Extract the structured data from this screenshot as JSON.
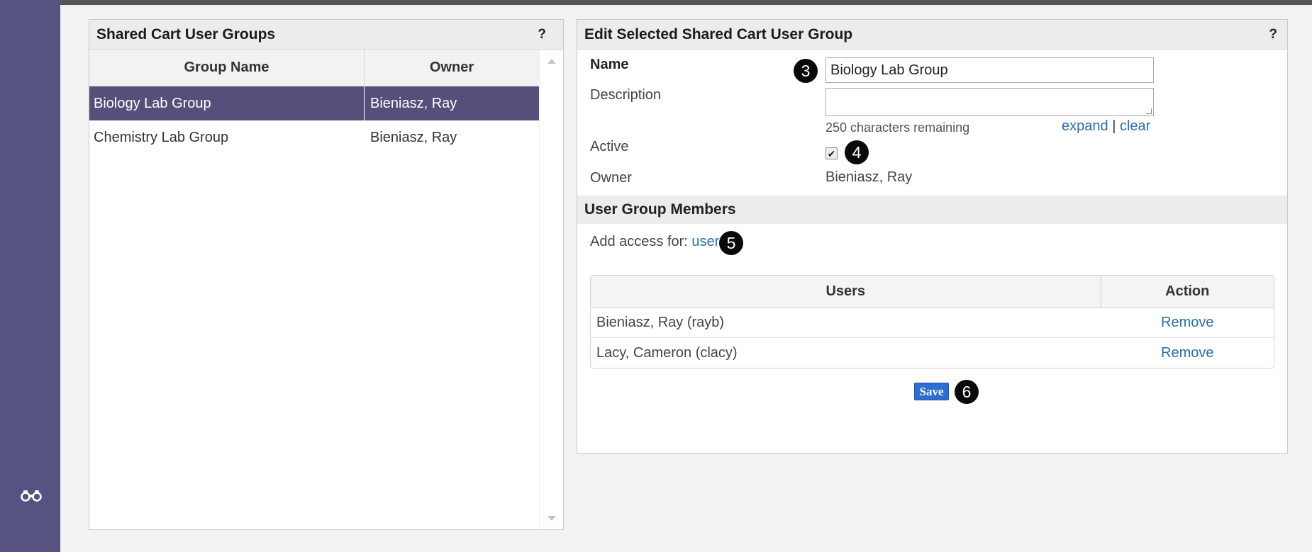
{
  "left_panel": {
    "title": "Shared Cart User Groups",
    "help": "?",
    "columns": [
      "Group Name",
      "Owner"
    ],
    "rows": [
      {
        "group_name": "Biology Lab Group",
        "owner": "Bieniasz, Ray",
        "selected": true
      },
      {
        "group_name": "Chemistry Lab Group",
        "owner": "Bieniasz, Ray",
        "selected": false
      }
    ]
  },
  "right_panel": {
    "title": "Edit Selected Shared Cart User Group",
    "help": "?",
    "name_label": "Name",
    "name_value": "Biology Lab Group",
    "description_label": "Description",
    "description_value": "",
    "chars_remaining": "250 characters remaining",
    "expand_label": "expand",
    "link_separator": "|",
    "clear_label": "clear",
    "active_label": "Active",
    "active_checked": true,
    "owner_label": "Owner",
    "owner_value": "Bieniasz, Ray",
    "members_section_title": "User Group Members",
    "add_access_prefix": "Add access for:",
    "add_access_link": "user",
    "users_columns": [
      "Users",
      "Action"
    ],
    "users": [
      {
        "name": "Bieniasz, Ray (rayb)",
        "action": "Remove"
      },
      {
        "name": "Lacy, Cameron (clacy)",
        "action": "Remove"
      }
    ],
    "save_label": "Save"
  },
  "markers": [
    "3",
    "4",
    "5",
    "6"
  ],
  "icons": {
    "left_rail": "binoculars-icon",
    "check": "checkmark-icon",
    "scroll_up": "scroll-up-arrow-icon",
    "scroll_down": "scroll-down-arrow-icon"
  },
  "colors": {
    "rail": "#565282",
    "selected_row": "#545079",
    "link": "#2a6fa8",
    "save_button": "#2d6fd1"
  }
}
